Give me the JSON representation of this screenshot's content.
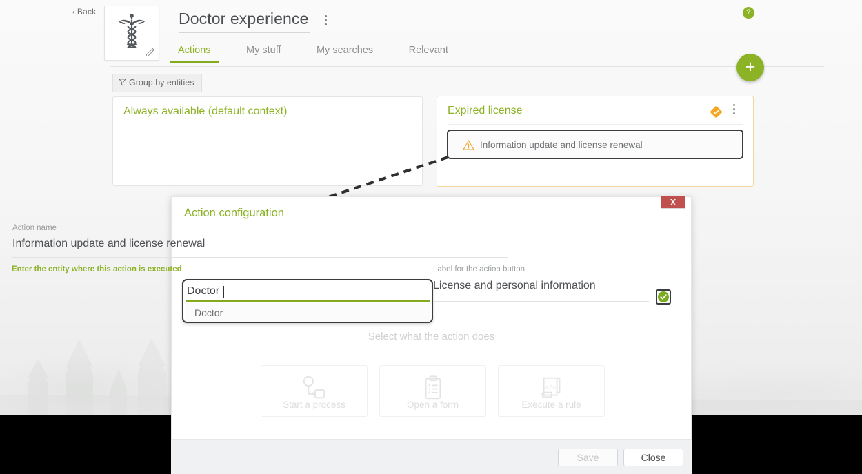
{
  "header": {
    "back_label": "Back",
    "back_icon": "chevron-left-icon",
    "app_logo_icon": "caduceus-icon",
    "edit_icon": "pencil-icon",
    "title": "Doctor experience",
    "title_menu_icon": "kebab-menu-icon",
    "help_icon": "question-mark-icon",
    "add_label": "+",
    "tabs": [
      {
        "label": "Actions",
        "active": true
      },
      {
        "label": "My stuff",
        "active": false
      },
      {
        "label": "My searches",
        "active": false
      },
      {
        "label": "Relevant",
        "active": false
      }
    ]
  },
  "toolbar": {
    "group_by_label": "Group by entities",
    "group_by_icon": "funnel-icon"
  },
  "contexts": [
    {
      "title": "Always available (default context)",
      "badge_icon": null,
      "menu_icon": null,
      "actions": []
    },
    {
      "title": "Expired license",
      "badge_icon": "diamond-check-icon",
      "menu_icon": "kebab-menu-icon",
      "actions": [
        {
          "label": "Information update and license renewal",
          "icon": "warning-triangle-icon"
        }
      ]
    }
  ],
  "dialog": {
    "title": "Action configuration",
    "close_x_label": "X",
    "fields": {
      "action_name": {
        "label": "Action name",
        "value": "Information update and license renewal"
      },
      "entity": {
        "label": "Enter the entity where this action is executed",
        "value": "Doctor",
        "placeholder": "",
        "suggestions": [
          "Doctor"
        ]
      },
      "button_label": {
        "label": "Label for the action button",
        "value": "License and personal information",
        "valid_icon": "check-circle-icon"
      }
    },
    "selector": {
      "hint": "Select what the action does",
      "options": [
        {
          "label": "Start a process",
          "icon": "process-flow-icon"
        },
        {
          "label": "Open a form",
          "icon": "clipboard-form-icon"
        },
        {
          "label": "Execute a rule",
          "icon": "code-scroll-icon"
        }
      ]
    },
    "footer": {
      "save_label": "Save",
      "save_disabled": true,
      "close_label": "Close"
    }
  },
  "colors": {
    "accent_green": "#8cb225",
    "tab_underline": "#84ab1d",
    "warning_yellow": "#f5a623",
    "close_red": "#c0504d",
    "muted_text": "#8c8e90"
  }
}
